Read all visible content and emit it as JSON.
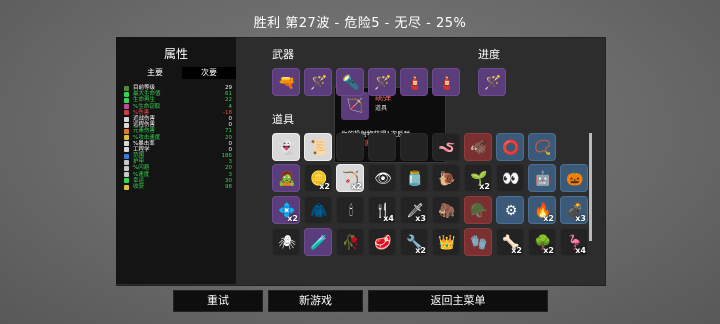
{
  "title": "胜利   第27波 - 危险5 - 无尽 - 25%",
  "attributes": {
    "title": "属性",
    "tabs": {
      "primary": "主要",
      "secondary": "次要"
    },
    "stats": [
      {
        "name": "目前等级",
        "value": "29",
        "color": "#ffffff",
        "icon_color": "#4b8b3b"
      },
      {
        "name": "最大生命值",
        "value": "61",
        "color": "#39d353",
        "icon_color": "#39d353"
      },
      {
        "name": "生命再生",
        "value": "22",
        "color": "#39d353",
        "icon_color": "#39d353"
      },
      {
        "name": "%生命窃取",
        "value": "4",
        "color": "#39d353",
        "icon_color": "#c04a9a"
      },
      {
        "name": "%伤害",
        "value": "-18",
        "color": "#ff4a4a",
        "icon_color": "#c24242"
      },
      {
        "name": "近战伤害",
        "value": "0",
        "color": "#ffffff",
        "icon_color": "#d8d8d8"
      },
      {
        "name": "远程伤害",
        "value": "0",
        "color": "#ffffff",
        "icon_color": "#d8d8d8"
      },
      {
        "name": "元素伤害",
        "value": "71",
        "color": "#39d353",
        "icon_color": "#e07a2a"
      },
      {
        "name": "%攻击速度",
        "value": "20",
        "color": "#39d353",
        "icon_color": "#d8c040"
      },
      {
        "name": "%暴击率",
        "value": "0",
        "color": "#ffffff",
        "icon_color": "#d8d8d8"
      },
      {
        "name": "工程学",
        "value": "0",
        "color": "#ffffff",
        "icon_color": "#d8d8d8"
      },
      {
        "name": "范围",
        "value": "186",
        "color": "#39d353",
        "icon_color": "#3a7ad8"
      },
      {
        "name": "护甲",
        "value": "3",
        "color": "#39d353",
        "icon_color": "#c8c8c8"
      },
      {
        "name": "%闪避",
        "value": "20",
        "color": "#39d353",
        "icon_color": "#c8c8c8"
      },
      {
        "name": "%速度",
        "value": "3",
        "color": "#39d353",
        "icon_color": "#c8c8c8"
      },
      {
        "name": "幸运",
        "value": "30",
        "color": "#39d353",
        "icon_color": "#39d353"
      },
      {
        "name": "收获",
        "value": "98",
        "color": "#39d353",
        "icon_color": "#d8c040"
      }
    ]
  },
  "weapons": {
    "title": "武器",
    "items": [
      {
        "icon": "cannon-icon",
        "glyph": "🔫",
        "tier": "purple"
      },
      {
        "icon": "wand-icon",
        "glyph": "🪄",
        "tier": "purple"
      },
      {
        "icon": "torch-icon",
        "glyph": "🔦",
        "tier": "purple"
      },
      {
        "icon": "wand-icon",
        "glyph": "🪄",
        "tier": "purple"
      },
      {
        "icon": "flamethrower-icon",
        "glyph": "🧯",
        "tier": "purple"
      },
      {
        "icon": "flamethrower-icon",
        "glyph": "🧯",
        "tier": "purple"
      }
    ]
  },
  "progress": {
    "title": "进度",
    "items": [
      {
        "icon": "wand-icon",
        "glyph": "🪄",
        "tier": "purple"
      }
    ]
  },
  "items": {
    "title": "道具",
    "grid": [
      [
        {
          "icon": "ghost-icon",
          "glyph": "👻",
          "tier": "white",
          "count": ""
        },
        {
          "icon": "scroll-icon",
          "glyph": "📜",
          "tier": "white",
          "count": ""
        },
        {
          "icon": "",
          "glyph": "",
          "tier": "dark",
          "count": ""
        },
        {
          "icon": "",
          "glyph": "",
          "tier": "dark",
          "count": ""
        },
        {
          "icon": "",
          "glyph": "",
          "tier": "dark",
          "count": ""
        },
        {
          "icon": "worm-icon",
          "glyph": "🪱",
          "tier": "dark",
          "count": ""
        },
        {
          "icon": "beast-icon",
          "glyph": "🐗",
          "tier": "red",
          "count": ""
        },
        {
          "icon": "ring-icon",
          "glyph": "⭕",
          "tier": "blue",
          "count": ""
        },
        {
          "icon": "necklace-icon",
          "glyph": "📿",
          "tier": "blue",
          "count": ""
        }
      ],
      [
        {
          "icon": "zombie-icon",
          "glyph": "🧟",
          "tier": "purple",
          "count": ""
        },
        {
          "icon": "coin-icon",
          "glyph": "🪙",
          "tier": "dark",
          "count": "x2"
        },
        {
          "icon": "slingshot-icon",
          "glyph": "🏹",
          "tier": "white",
          "count": "x2"
        },
        {
          "icon": "eyeball-icon",
          "glyph": "👁",
          "tier": "dark",
          "count": ""
        },
        {
          "icon": "jar-icon",
          "glyph": "🫙",
          "tier": "dark",
          "count": ""
        },
        {
          "icon": "snail-icon",
          "glyph": "🐌",
          "tier": "dark",
          "count": ""
        },
        {
          "icon": "plant-icon",
          "glyph": "🌱",
          "tier": "dark",
          "count": "x2"
        },
        {
          "icon": "eyes-icon",
          "glyph": "👀",
          "tier": "dark",
          "count": ""
        },
        {
          "icon": "robot-icon",
          "glyph": "🤖",
          "tier": "blue",
          "count": ""
        },
        {
          "icon": "pumpkin-icon",
          "glyph": "🎃",
          "tier": "blue",
          "count": ""
        }
      ],
      [
        {
          "icon": "gem-icon",
          "glyph": "💠",
          "tier": "purple",
          "count": "x2"
        },
        {
          "icon": "armor-icon",
          "glyph": "🧥",
          "tier": "dark",
          "count": ""
        },
        {
          "icon": "candle-icon",
          "glyph": "🕯",
          "tier": "dark",
          "count": ""
        },
        {
          "icon": "fork-icon",
          "glyph": "🍴",
          "tier": "dark",
          "count": "x4"
        },
        {
          "icon": "dagger-icon",
          "glyph": "🗡",
          "tier": "dark",
          "count": "x3"
        },
        {
          "icon": "mammoth-icon",
          "glyph": "🦣",
          "tier": "dark",
          "count": ""
        },
        {
          "icon": "bullet-icon",
          "glyph": "🪖",
          "tier": "red",
          "count": ""
        },
        {
          "icon": "machine-icon",
          "glyph": "⚙",
          "tier": "blue",
          "count": ""
        },
        {
          "icon": "fire-icon",
          "glyph": "🔥",
          "tier": "blue",
          "count": "x2"
        },
        {
          "icon": "bomb-icon",
          "glyph": "💣",
          "tier": "blue",
          "count": "x3"
        }
      ],
      [
        {
          "icon": "spider-icon",
          "glyph": "🕷",
          "tier": "dark",
          "count": ""
        },
        {
          "icon": "potion-icon",
          "glyph": "🧪",
          "tier": "purple",
          "count": ""
        },
        {
          "icon": "rose-icon",
          "glyph": "🥀",
          "tier": "dark",
          "count": ""
        },
        {
          "icon": "meat-icon",
          "glyph": "🥩",
          "tier": "dark",
          "count": ""
        },
        {
          "icon": "tool-icon",
          "glyph": "🔧",
          "tier": "dark",
          "count": "x2"
        },
        {
          "icon": "crown-icon",
          "glyph": "👑",
          "tier": "dark",
          "count": ""
        },
        {
          "icon": "glove-icon",
          "glyph": "🧤",
          "tier": "red",
          "count": ""
        },
        {
          "icon": "bone-icon",
          "glyph": "🦴",
          "tier": "dark",
          "count": "x2"
        },
        {
          "icon": "tree-icon",
          "glyph": "🌳",
          "tier": "dark",
          "count": "x2"
        },
        {
          "icon": "flamingo-icon",
          "glyph": "🦩",
          "tier": "dark",
          "count": "x4"
        }
      ]
    ]
  },
  "tooltip": {
    "name": "跳弹",
    "type": "道具",
    "line1": "你的投射物获得1次反弹",
    "line2": "-30%伤害",
    "glyph": "🏹"
  },
  "buttons": {
    "retry": "重试",
    "new_game": "新游戏",
    "main_menu": "返回主菜单"
  }
}
